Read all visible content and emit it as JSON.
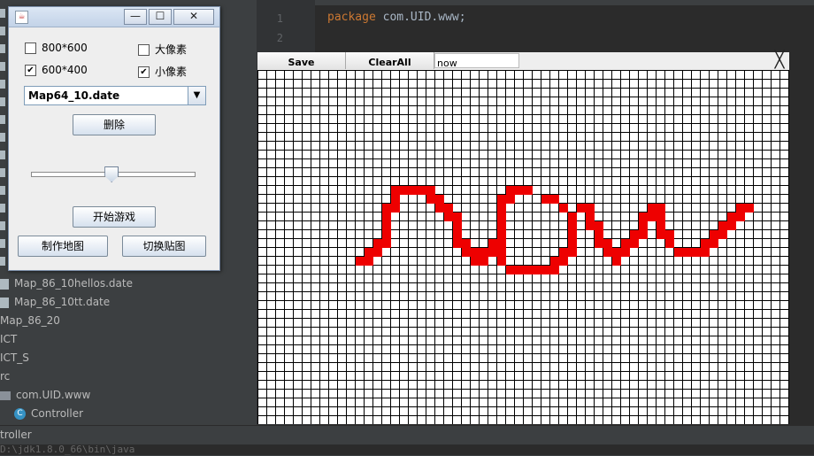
{
  "ide": {
    "tree_items": [
      "Map_86_10hellos.date",
      "Map_86_10tt.date",
      "Map_86_20",
      "ICT",
      "ICT_S",
      "rc",
      "com.UID.www",
      "Controller"
    ],
    "bottom_label": "troller",
    "console_text": "D:\\jdk1.8.0_66\\bin\\java",
    "line_numbers": [
      "1",
      "2"
    ],
    "code_keyword": "package",
    "code_rest": " com.UID.www;"
  },
  "control_window": {
    "options": [
      {
        "label": "800*600",
        "checked": false
      },
      {
        "label": "大像素",
        "checked": false
      },
      {
        "label": "600*400",
        "checked": true
      },
      {
        "label": "小像素",
        "checked": true
      }
    ],
    "map_file": "Map64_10.date",
    "delete_button": "删除",
    "slider_value": 0.49,
    "start_game_button": "开始游戏",
    "make_map_button": "制作地图",
    "switch_texture_button": "切换贴图"
  },
  "map_editor": {
    "save_button": "Save",
    "clear_all_button": "ClearAll",
    "name_input_value": "now",
    "close_glyph": "╳",
    "grid_cols": 60,
    "grid_rows": 40,
    "fill_color": "#ee0000",
    "filled_cells": [
      [
        11,
        21
      ],
      [
        12,
        20
      ],
      [
        12,
        21
      ],
      [
        13,
        19
      ],
      [
        13,
        20
      ],
      [
        14,
        15
      ],
      [
        14,
        16
      ],
      [
        14,
        17
      ],
      [
        14,
        18
      ],
      [
        14,
        19
      ],
      [
        15,
        13
      ],
      [
        15,
        14
      ],
      [
        15,
        15
      ],
      [
        16,
        13
      ],
      [
        17,
        13
      ],
      [
        18,
        13
      ],
      [
        19,
        13
      ],
      [
        19,
        14
      ],
      [
        20,
        14
      ],
      [
        20,
        15
      ],
      [
        21,
        15
      ],
      [
        21,
        16
      ],
      [
        22,
        16
      ],
      [
        22,
        17
      ],
      [
        22,
        18
      ],
      [
        22,
        19
      ],
      [
        23,
        19
      ],
      [
        23,
        20
      ],
      [
        24,
        20
      ],
      [
        24,
        21
      ],
      [
        25,
        20
      ],
      [
        25,
        21
      ],
      [
        26,
        19
      ],
      [
        26,
        20
      ],
      [
        27,
        14
      ],
      [
        27,
        15
      ],
      [
        27,
        16
      ],
      [
        27,
        17
      ],
      [
        27,
        18
      ],
      [
        27,
        19
      ],
      [
        27,
        20
      ],
      [
        27,
        21
      ],
      [
        28,
        13
      ],
      [
        28,
        14
      ],
      [
        28,
        22
      ],
      [
        29,
        13
      ],
      [
        29,
        22
      ],
      [
        30,
        13
      ],
      [
        30,
        22
      ],
      [
        31,
        22
      ],
      [
        32,
        14
      ],
      [
        32,
        22
      ],
      [
        33,
        14
      ],
      [
        33,
        21
      ],
      [
        33,
        22
      ],
      [
        34,
        15
      ],
      [
        34,
        20
      ],
      [
        34,
        21
      ],
      [
        35,
        16
      ],
      [
        35,
        17
      ],
      [
        35,
        18
      ],
      [
        35,
        19
      ],
      [
        35,
        20
      ],
      [
        36,
        15
      ],
      [
        37,
        15
      ],
      [
        37,
        16
      ],
      [
        37,
        17
      ],
      [
        38,
        17
      ],
      [
        38,
        18
      ],
      [
        38,
        19
      ],
      [
        39,
        19
      ],
      [
        39,
        20
      ],
      [
        40,
        20
      ],
      [
        40,
        21
      ],
      [
        41,
        19
      ],
      [
        41,
        20
      ],
      [
        42,
        18
      ],
      [
        42,
        19
      ],
      [
        43,
        16
      ],
      [
        43,
        17
      ],
      [
        43,
        18
      ],
      [
        44,
        15
      ],
      [
        44,
        16
      ],
      [
        45,
        15
      ],
      [
        45,
        16
      ],
      [
        45,
        17
      ],
      [
        45,
        18
      ],
      [
        46,
        18
      ],
      [
        46,
        19
      ],
      [
        47,
        20
      ],
      [
        48,
        20
      ],
      [
        49,
        20
      ],
      [
        50,
        20
      ],
      [
        50,
        19
      ],
      [
        51,
        18
      ],
      [
        51,
        19
      ],
      [
        52,
        17
      ],
      [
        52,
        18
      ],
      [
        53,
        16
      ],
      [
        53,
        17
      ],
      [
        54,
        15
      ],
      [
        54,
        16
      ],
      [
        55,
        15
      ]
    ]
  }
}
